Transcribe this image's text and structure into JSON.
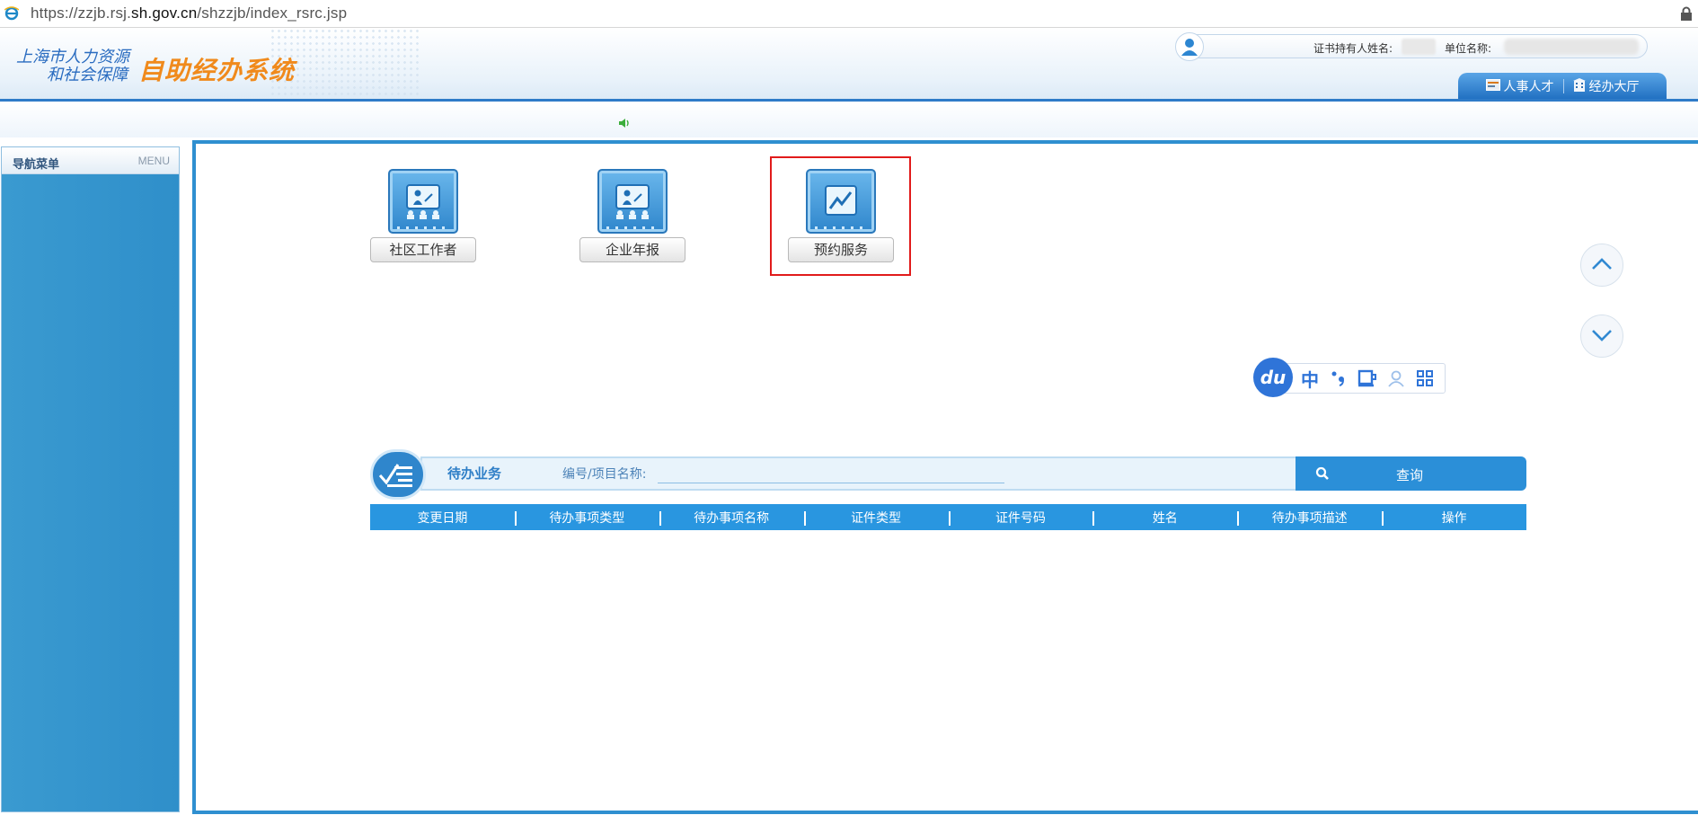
{
  "browser": {
    "url_prefix": "https://zzjb.rsj.",
    "url_domain": "sh.gov.cn",
    "url_suffix": "/shzzjb/index_rsrc.jsp"
  },
  "header": {
    "logo_line1": "上海市人力资源",
    "logo_line2": "和社会保障",
    "logo_system": "自助经办系统",
    "cert_holder_label": "证书持有人姓名:",
    "company_label": "单位名称:",
    "tabs": [
      {
        "label": "人事人才"
      },
      {
        "label": "经办大厅"
      }
    ]
  },
  "sidebar": {
    "title": "导航菜单",
    "menu_label": "MENU"
  },
  "shortcuts": [
    {
      "label": "社区工作者",
      "icon": "presentation-icon"
    },
    {
      "label": "企业年报",
      "icon": "presentation-icon"
    },
    {
      "label": "预约服务",
      "icon": "chart-icon"
    }
  ],
  "todo": {
    "title": "待办业务",
    "search_label": "编号/项目名称:",
    "search_value": "",
    "search_button": "查询"
  },
  "table": {
    "columns": [
      "变更日期",
      "待办事项类型",
      "待办事项名称",
      "证件类型",
      "证件号码",
      "姓名",
      "待办事项描述",
      "操作"
    ]
  },
  "baidu_toolbar": {
    "logo": "du",
    "lang": "中"
  },
  "colors": {
    "accent": "#2f8fd0",
    "orange": "#f08a1c",
    "highlight": "#e11b1b"
  }
}
